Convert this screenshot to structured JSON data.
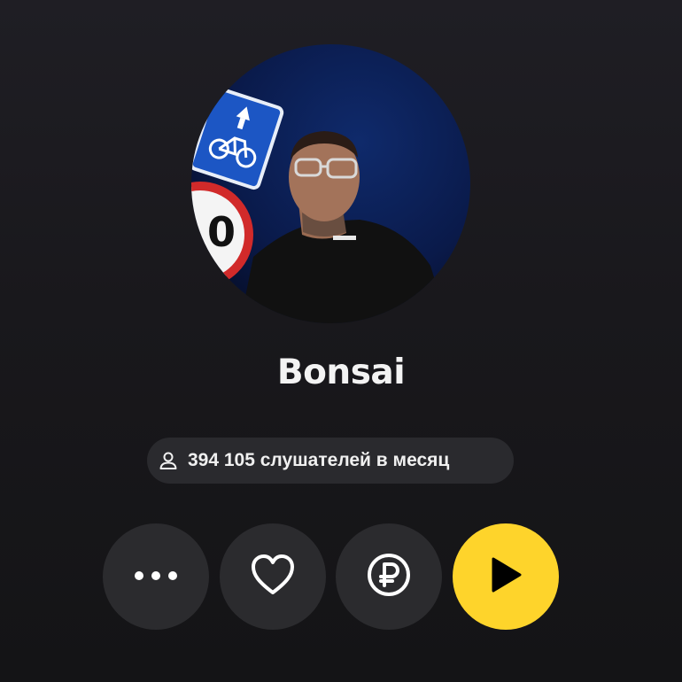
{
  "artist": {
    "name": "Bonsai",
    "avatar_icon": "artist-avatar-photo"
  },
  "listeners": {
    "text": "394 105 слушателей в месяц",
    "icon": "person-icon"
  },
  "actions": [
    {
      "id": "more",
      "icon": "more-dots-icon"
    },
    {
      "id": "like",
      "icon": "heart-icon"
    },
    {
      "id": "donate",
      "icon": "ruble-icon"
    },
    {
      "id": "play",
      "icon": "play-icon"
    }
  ],
  "colors": {
    "background": "#1a191d",
    "button": "#2b2b2e",
    "badge": "#2a2a2e",
    "accent": "#fed42b",
    "text": "#f3f3f3"
  }
}
